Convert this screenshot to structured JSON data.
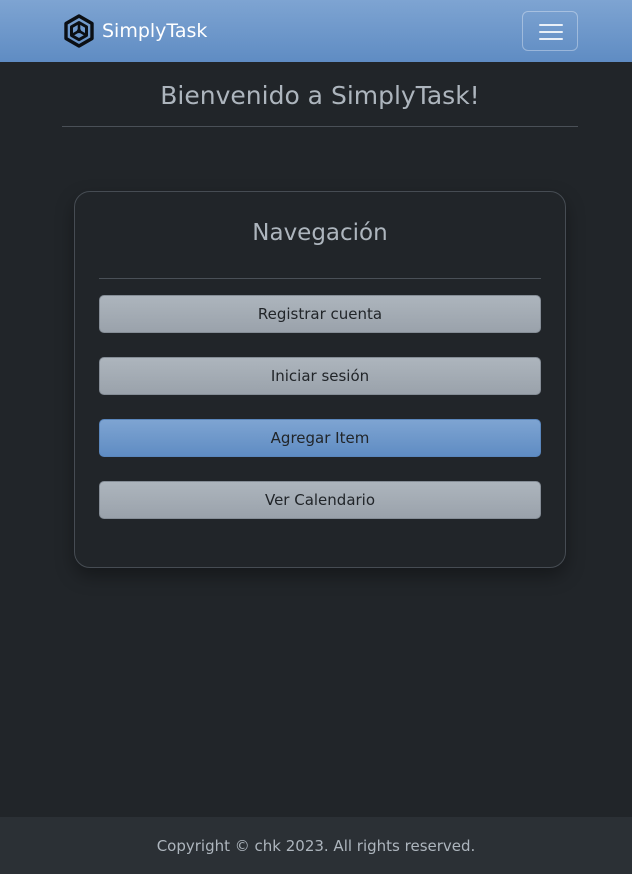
{
  "navbar": {
    "brand_name": "SimplyTask",
    "logo_icon": "hexagon-cube-logo-icon",
    "menu_icon": "hamburger-menu-icon",
    "gradient_top": "#7ea4d2",
    "gradient_bottom": "#5f8cc3"
  },
  "header": {
    "title": "Bienvenido a SimplyTask!"
  },
  "navigation_card": {
    "title": "Navegación",
    "buttons": [
      {
        "label": "Registrar cuenta",
        "style": "secondary"
      },
      {
        "label": "Iniciar sesión",
        "style": "secondary"
      },
      {
        "label": "Agregar Item",
        "style": "primary"
      },
      {
        "label": "Ver Calendario",
        "style": "secondary"
      }
    ]
  },
  "footer": {
    "text": "Copyright © chk 2023. All rights reserved."
  },
  "colors": {
    "background": "#212529",
    "text_muted": "#adb5bd",
    "primary": "#6a95c9",
    "secondary": "#a3abb4",
    "footer_bg": "#2b3035"
  }
}
